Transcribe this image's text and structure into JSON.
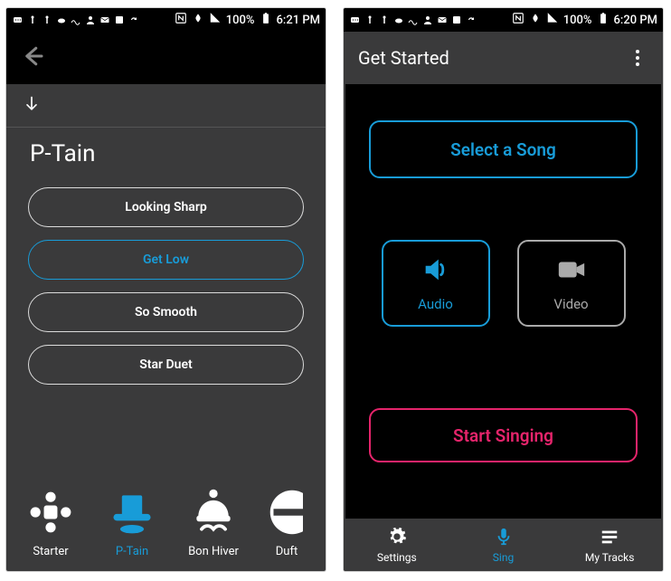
{
  "status_bar": {
    "battery": "100%",
    "time_left": "6:21 PM",
    "time_right": "6:20 PM"
  },
  "screen1": {
    "title": "P-Tain",
    "effects": [
      {
        "label": "Looking Sharp",
        "active": false
      },
      {
        "label": "Get Low",
        "active": true
      },
      {
        "label": "So Smooth",
        "active": false
      },
      {
        "label": "Star Duet",
        "active": false
      }
    ],
    "voices": [
      {
        "label": "Starter",
        "active": false
      },
      {
        "label": "P-Tain",
        "active": true
      },
      {
        "label": "Bon Hiver",
        "active": false
      },
      {
        "label": "Duft",
        "active": false
      }
    ]
  },
  "screen2": {
    "header": "Get Started",
    "select_song": "Select a Song",
    "modes": {
      "audio": "Audio",
      "video": "Video"
    },
    "start": "Start Singing",
    "nav": {
      "settings": "Settings",
      "sing": "Sing",
      "mytracks": "My Tracks"
    }
  }
}
